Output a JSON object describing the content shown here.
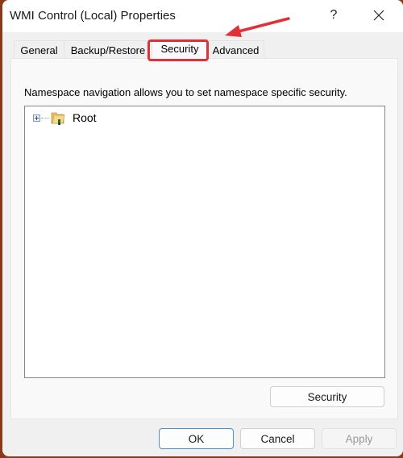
{
  "window": {
    "title": "WMI Control (Local) Properties",
    "help_label": "?",
    "close_icon": "close-icon"
  },
  "tabs": [
    {
      "label": "General",
      "selected": false
    },
    {
      "label": "Backup/Restore",
      "selected": false
    },
    {
      "label": "Security",
      "selected": true
    },
    {
      "label": "Advanced",
      "selected": false
    }
  ],
  "security_page": {
    "description": "Namespace navigation allows you to set namespace specific security.",
    "tree": [
      {
        "label": "Root",
        "icon": "folder-icon",
        "expanded": false
      }
    ],
    "security_button": "Security"
  },
  "footer": {
    "ok": "OK",
    "cancel": "Cancel",
    "apply": "Apply"
  },
  "annotation": {
    "highlight_color": "#e0303a",
    "arrow_color": "#e0303a",
    "target": "Security tab"
  }
}
